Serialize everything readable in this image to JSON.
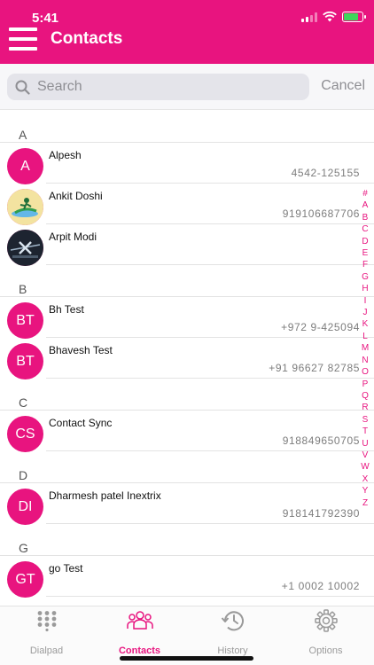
{
  "status_bar": {
    "time": "5:41"
  },
  "header": {
    "title": "Contacts"
  },
  "search": {
    "placeholder": "Search",
    "cancel_label": "Cancel"
  },
  "sections": [
    {
      "letter": "A",
      "contacts": [
        {
          "name": "Alpesh",
          "number": "4542-125155",
          "avatar": "initials",
          "initials": "A"
        },
        {
          "name": "Ankit Doshi",
          "number": "919106687706",
          "avatar": "photo",
          "avatar_icon": "surfer-photo-icon"
        },
        {
          "name": "Arpit Modi",
          "number": "",
          "avatar": "photo",
          "avatar_icon": "xbox-logo-photo-icon"
        }
      ]
    },
    {
      "letter": "B",
      "contacts": [
        {
          "name": "Bh Test",
          "number": "+972 9-425094",
          "avatar": "initials",
          "initials": "BT"
        },
        {
          "name": "Bhavesh Test",
          "number": "+91 96627 82785",
          "avatar": "initials",
          "initials": "BT"
        }
      ]
    },
    {
      "letter": "C",
      "contacts": [
        {
          "name": "Contact Sync",
          "number": "918849650705",
          "avatar": "initials",
          "initials": "CS"
        }
      ]
    },
    {
      "letter": "D",
      "contacts": [
        {
          "name": "Dharmesh patel Inextrix",
          "number": "918141792390",
          "avatar": "initials",
          "initials": "DI"
        }
      ]
    },
    {
      "letter": "G",
      "contacts": [
        {
          "name": "go Test",
          "number": "+1 0002 10002",
          "avatar": "initials",
          "initials": "GT"
        }
      ]
    }
  ],
  "alphabet_index": [
    "#",
    "A",
    "B",
    "C",
    "D",
    "E",
    "F",
    "G",
    "H",
    "I",
    "J",
    "K",
    "L",
    "M",
    "N",
    "O",
    "P",
    "Q",
    "R",
    "S",
    "T",
    "U",
    "V",
    "W",
    "X",
    "Y",
    "Z"
  ],
  "tabs": [
    {
      "id": "dialpad",
      "label": "Dialpad",
      "icon": "dialpad-icon",
      "active": false
    },
    {
      "id": "contacts",
      "label": "Contacts",
      "icon": "contacts-icon",
      "active": true
    },
    {
      "id": "history",
      "label": "History",
      "icon": "history-icon",
      "active": false
    },
    {
      "id": "options",
      "label": "Options",
      "icon": "options-gear-icon",
      "active": false
    }
  ],
  "colors": {
    "accent": "#e8147f",
    "inactive": "#9a9a9a",
    "battery": "#3dd65b"
  }
}
